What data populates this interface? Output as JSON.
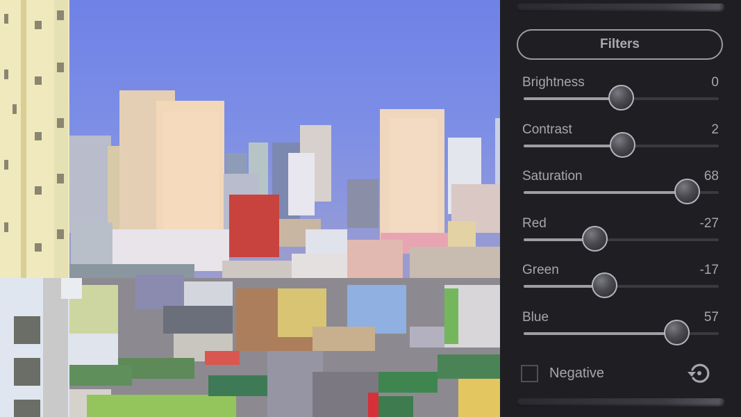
{
  "panel": {
    "title_button": "Filters",
    "sliders": [
      {
        "label": "Brightness",
        "value": 0,
        "min": -100,
        "max": 100
      },
      {
        "label": "Contrast",
        "value": 2,
        "min": -100,
        "max": 100
      },
      {
        "label": "Saturation",
        "value": 68,
        "min": -100,
        "max": 100
      },
      {
        "label": "Red",
        "value": -27,
        "min": -100,
        "max": 100
      },
      {
        "label": "Green",
        "value": -17,
        "min": -100,
        "max": 100
      },
      {
        "label": "Blue",
        "value": 57,
        "min": -100,
        "max": 100
      }
    ],
    "negative": {
      "label": "Negative",
      "checked": false
    },
    "reset_icon": "reset-rotate-icon"
  },
  "photo": {
    "description": "City skyline photo with high-rise towers under a blue sky and dense low-rise rooftops"
  },
  "colors": {
    "panel_bg": "#1f1f23",
    "text": "#a6a6ac",
    "track_fill": "#9e9ea4",
    "track_empty": "#3a3a3f"
  }
}
